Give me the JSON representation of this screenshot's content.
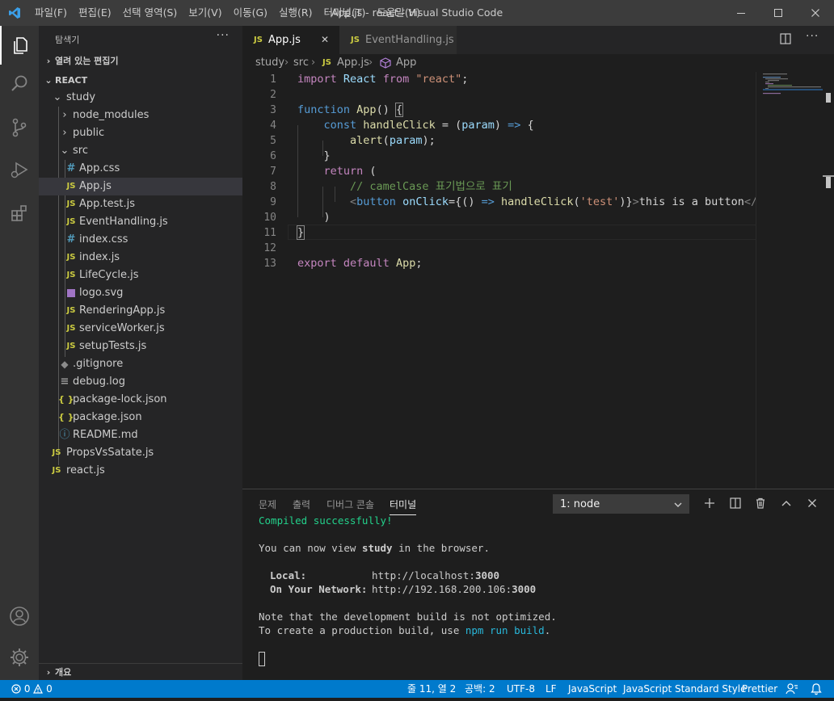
{
  "window": {
    "title": "App.js - react - Visual Studio Code",
    "menu": [
      "파일(F)",
      "편집(E)",
      "선택 영역(S)",
      "보기(V)",
      "이동(G)",
      "실행(R)",
      "터미널(T)",
      "도움말(H)"
    ]
  },
  "colors": {
    "accent": "#007acc",
    "activity_bar": "#333333",
    "sidebar": "#252526",
    "editor": "#1e1e1e",
    "js_icon": "#cbcb41",
    "css_icon": "#519aba",
    "terminal_green": "#23d18b"
  },
  "activity_icons": [
    "explorer-icon",
    "search-icon",
    "source-control-icon",
    "run-debug-icon",
    "extensions-icon",
    "account-icon",
    "settings-gear-icon"
  ],
  "sidebar": {
    "title": "탐색기",
    "more": "···",
    "open_editors": "열려 있는 편집기",
    "project": "REACT",
    "tree": {
      "study": "study",
      "node_modules": "node_modules",
      "public": "public",
      "src": "src",
      "src_files": [
        "App.css",
        "App.js",
        "App.test.js",
        "EventHandling.js",
        "index.css",
        "index.js",
        "LifeCycle.js",
        "logo.svg",
        "RenderingApp.js",
        "serviceWorker.js",
        "setupTests.js"
      ],
      "study_files": [
        ".gitignore",
        "debug.log",
        "package-lock.json",
        "package.json",
        "README.md"
      ],
      "root_files": [
        "PropsVsSatate.js",
        "react.js"
      ]
    },
    "outline": "개요"
  },
  "editor": {
    "tabs": [
      {
        "label": "App.js",
        "icon": "JS",
        "close": "✕"
      },
      {
        "label": "EventHandling.js",
        "icon": "JS"
      }
    ],
    "breadcrumb": {
      "parts": [
        "study",
        "src",
        "App.js",
        "App"
      ],
      "js_icon": "JS"
    },
    "line_numbers": [
      "1",
      "2",
      "3",
      "4",
      "5",
      "6",
      "7",
      "8",
      "9",
      "10",
      "11",
      "12",
      "13"
    ],
    "code": {
      "l1_import": "import",
      "l1_react": "React",
      "l1_from": "from",
      "l1_str": "\"react\"",
      "l3_function": "function",
      "l3_name": "App",
      "l4_const": "const",
      "l4_name": "handleClick",
      "l4_param": "param",
      "l5_alert": "alert",
      "l5_param": "param",
      "l7_return": "return",
      "l8_comment": "// camelCase 표기법으로 표기",
      "l9_tag": "button",
      "l9_attr": "onClick",
      "l9_call": "handleClick",
      "l9_arg": "'test'",
      "l9_text": "this is a button",
      "l9_close": "</butt",
      "l13_export": "export",
      "l13_default": "default",
      "l13_name": "App"
    }
  },
  "panel": {
    "tabs": [
      "문제",
      "출력",
      "디버그 콘솔",
      "터미널"
    ],
    "terminal_select": "1: node",
    "terminal": {
      "compiled": "Compiled successfully!",
      "view_pre": "You can now view ",
      "view_app": "study",
      "view_post": " in the browser.",
      "local_label": "Local:",
      "local_url": "http://localhost:",
      "local_port": "3000",
      "network_label": "On Your Network:",
      "network_url": "http://192.168.200.106:",
      "network_port": "3000",
      "note1": "Note that the development build is not optimized.",
      "note2_pre": "To create a production build, use ",
      "note2_cmd": "npm run build",
      "note2_post": "."
    }
  },
  "statusbar": {
    "errors": "0",
    "warnings": "0",
    "position": "줄 11, 열 2",
    "spaces": "공백: 2",
    "encoding": "UTF-8",
    "eol": "LF",
    "language": "JavaScript",
    "linter": "JavaScript Standard Style",
    "formatter": "Prettier"
  }
}
